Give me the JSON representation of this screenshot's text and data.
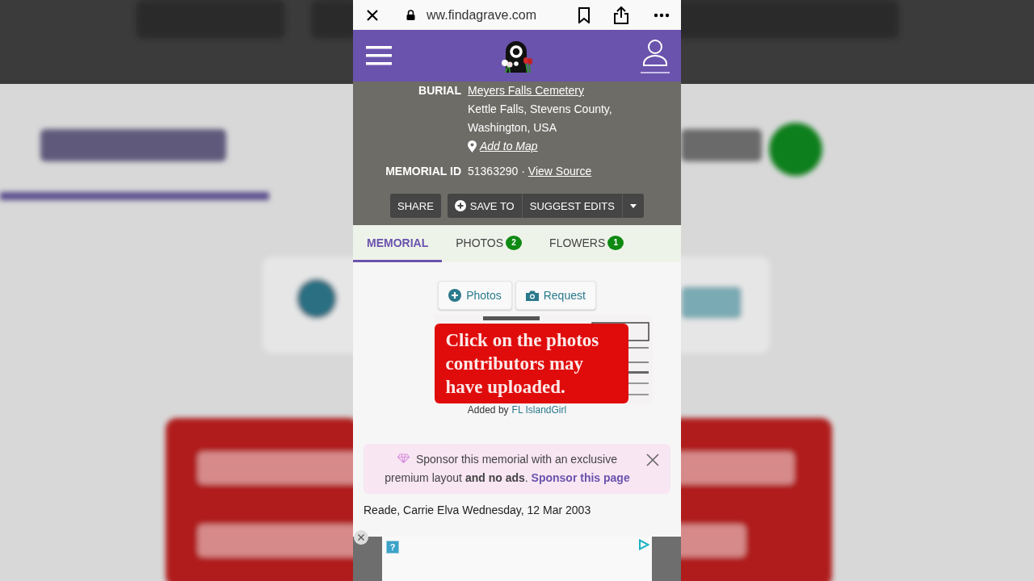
{
  "browser": {
    "url": "ww.findagrave.com"
  },
  "burial": {
    "label": "BURIAL",
    "cemetery": "Meyers Falls Cemetery",
    "location_lines": [
      "Kettle Falls, Stevens County,",
      "Washington, USA"
    ],
    "map_link": "Add to Map"
  },
  "memorial_id": {
    "label": "MEMORIAL ID",
    "value": "51363290 ·",
    "link": "View Source"
  },
  "actions": {
    "share": "SHARE",
    "save": "SAVE TO",
    "suggest": "SUGGEST EDITS"
  },
  "tabs": [
    {
      "label": "MEMORIAL",
      "selected": true
    },
    {
      "label": "PHOTOS",
      "count": "2",
      "selected": false
    },
    {
      "label": "FLOWERS",
      "count": "1",
      "selected": false
    }
  ],
  "photo_buttons": [
    {
      "kind": "add",
      "label": "Photos"
    },
    {
      "kind": "camera",
      "label": "Request"
    }
  ],
  "caption": "Click on the photos contributors may have uploaded.",
  "added_by": {
    "prefix": "Added by",
    "user": "FL IslandGirl"
  },
  "sponsor": {
    "text": "Sponsor this memorial with an exclusive premium layout **and no ads**.",
    "link": "Sponsor this page"
  },
  "entry": "Reade, Carrie Elva Wednesday, 12 Mar 2003",
  "ad": {
    "info": "?"
  }
}
